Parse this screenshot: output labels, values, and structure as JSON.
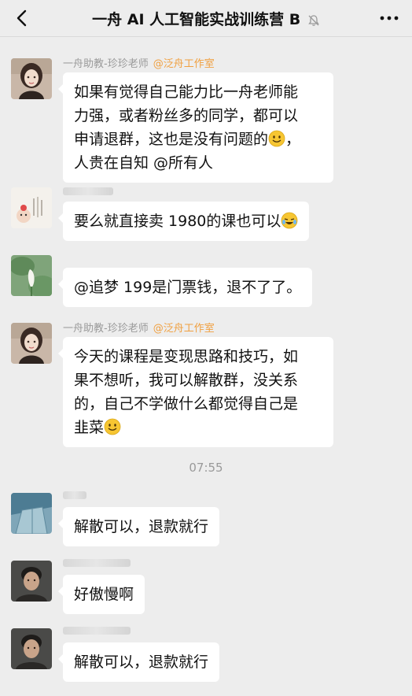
{
  "header": {
    "back_icon": "chevron-left-icon",
    "title": "一舟 AI 人工智能实战训练营 B",
    "mute_icon": "bell-off-icon",
    "more_icon": "ellipsis-icon"
  },
  "messages": [
    {
      "sender": "一舟助教-珍珍老师",
      "tag": "@泛舟工作室",
      "lines": [
        "如果有觉得自己能力比一舟老师能",
        "力强，或者粉丝多的同学，都可以",
        "申请退群，这也是没有问题的",
        "人贵在自知 @所有人"
      ],
      "line3_suffix": "，"
    },
    {
      "text": "要么就直接卖 1980的课也可以"
    },
    {
      "text": "@追梦 199是门票钱，退不了了。"
    },
    {
      "sender": "一舟助教-珍珍老师",
      "tag": "@泛舟工作室",
      "lines": [
        "今天的课程是变现思路和技巧，如",
        "果不想听，我可以解散群，没关系",
        "的，自己不学做什么都觉得自己是",
        "韭菜"
      ]
    },
    {
      "text": "解散可以，退款就行"
    },
    {
      "text": "好傲慢啊"
    },
    {
      "text": "解散可以，退款就行"
    }
  ],
  "timestamp": "07:55"
}
